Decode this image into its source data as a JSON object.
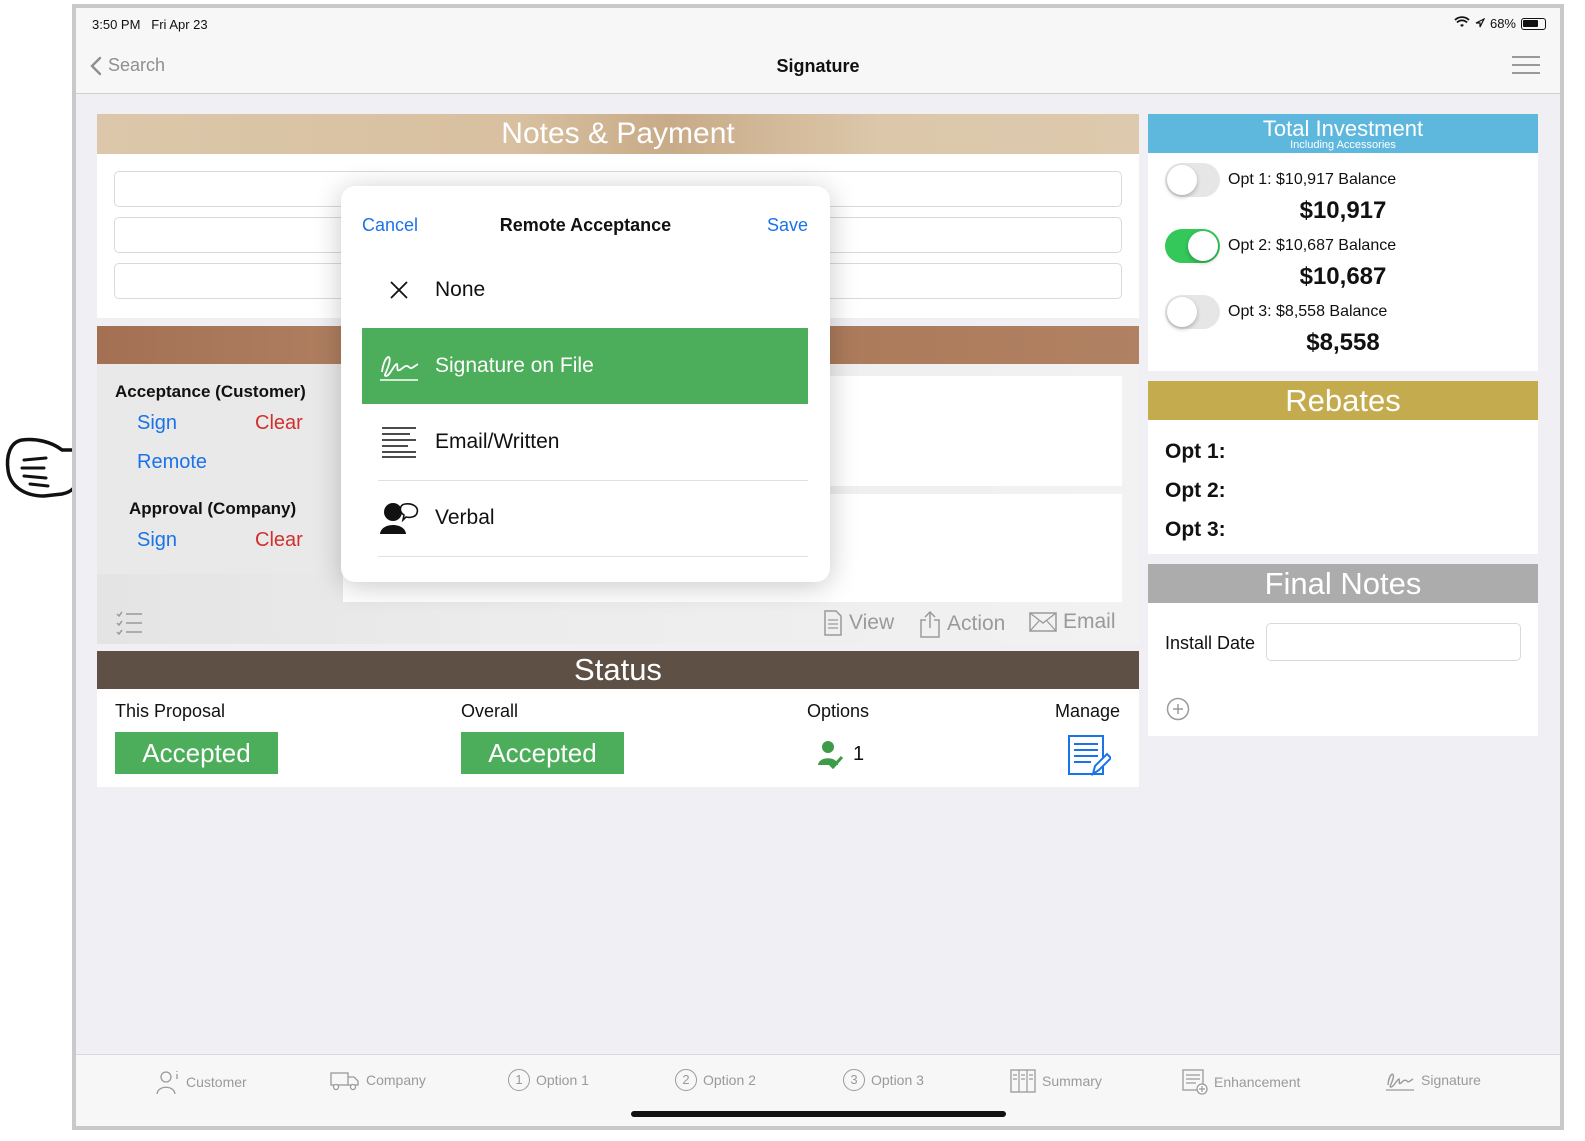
{
  "status_bar": {
    "time": "3:50 PM",
    "date": "Fri Apr 23",
    "battery": "68%"
  },
  "nav": {
    "back_label": "Search",
    "title": "Signature"
  },
  "notes_payment": {
    "title": "Notes & Payment"
  },
  "signature": {
    "acceptance_label": "Acceptance (Customer)",
    "approval_label": "Approval (Company)",
    "sign": "Sign",
    "clear": "Clear",
    "remote": "Remote",
    "view": "View",
    "action": "Action",
    "email": "Email"
  },
  "status": {
    "title": "Status",
    "this_proposal": "This Proposal",
    "overall": "Overall",
    "options": "Options",
    "manage": "Manage",
    "this_proposal_value": "Accepted",
    "overall_value": "Accepted",
    "options_count": "1"
  },
  "total_investment": {
    "title": "Total Investment",
    "subtitle": "Including Accessories",
    "options": [
      {
        "label": "Opt 1: $10,917 Balance",
        "amount": "$10,917",
        "on": false
      },
      {
        "label": "Opt 2: $10,687 Balance",
        "amount": "$10,687",
        "on": true
      },
      {
        "label": "Opt 3: $8,558 Balance",
        "amount": "$8,558",
        "on": false
      }
    ]
  },
  "rebates": {
    "title": "Rebates",
    "lines": [
      "Opt 1:",
      "Opt 2:",
      "Opt 3:"
    ]
  },
  "final_notes": {
    "title": "Final Notes",
    "install_date_label": "Install Date"
  },
  "popover": {
    "cancel": "Cancel",
    "title": "Remote Acceptance",
    "save": "Save",
    "items": [
      "None",
      "Signature on File",
      "Email/Written",
      "Verbal"
    ],
    "selected": "Signature on File"
  },
  "tabs": [
    "Customer",
    "Company",
    "Option 1",
    "Option 2",
    "Option 3",
    "Summary",
    "Enhancement",
    "Signature"
  ],
  "colors": {
    "accent_blue": "#1a73e8",
    "green": "#4cae5a",
    "red": "#d0312d",
    "toggle_green": "#34c759"
  }
}
